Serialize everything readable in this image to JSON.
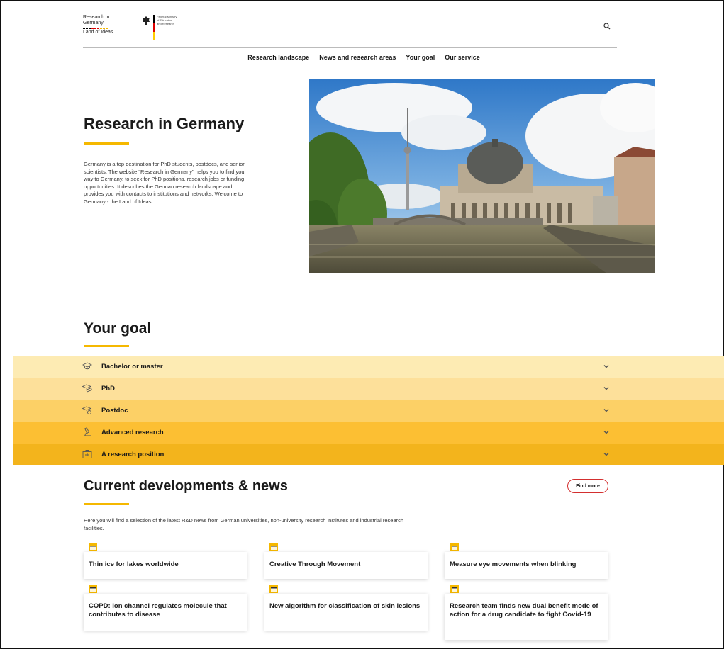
{
  "header": {
    "logo_title_line1": "Research in",
    "logo_title_line2": "Germany",
    "logo_sub": "Land of Ideas",
    "ministry_line1": "Federal Ministry",
    "ministry_line2": "of Education",
    "ministry_line3": "and Research",
    "search_icon": "search-icon"
  },
  "nav": {
    "items": [
      "Research landscape",
      "News and research areas",
      "Your goal",
      "Our service"
    ]
  },
  "hero": {
    "title": "Research in Germany",
    "text": "Germany is a top destination for PhD students, postdocs, and senior scientists. The website \"Research in Germany\" helps you to find your way to Germany, to seek for PhD positions, research jobs or funding opportunities. It describes the German research landscape and provides you with contacts to institutions and networks. Welcome to Germany - the Land of Ideas!"
  },
  "goal": {
    "title": "Your goal",
    "items": [
      {
        "label": "Bachelor or master",
        "icon": "graduation-cap-icon",
        "color": "#fdebb3"
      },
      {
        "label": "PhD",
        "icon": "graduation-scroll-icon",
        "color": "#fde09a"
      },
      {
        "label": "Postdoc",
        "icon": "diploma-icon",
        "color": "#fcd066"
      },
      {
        "label": "Advanced research",
        "icon": "microscope-icon",
        "color": "#fcbf33"
      },
      {
        "label": "A research position",
        "icon": "briefcase-icon",
        "color": "#f3b41c"
      }
    ]
  },
  "news": {
    "title": "Current developments & news",
    "find_more": "Find more",
    "text": "Here you will find a selection of the latest R&D news from German universities, non-university research institutes and industrial research facilities.",
    "cards": [
      "Thin ice for lakes worldwide",
      "Creative Through Movement",
      "Measure eye movements when blinking",
      "COPD: Ion channel regulates molecule that contributes to disease",
      "New algorithm for classification of skin lesions",
      "Research team finds new dual benefit mode of action for a drug candidate to fight Covid-19"
    ]
  },
  "colors": {
    "accent": "#f5b800",
    "find_more_border": "#d32f2f"
  }
}
